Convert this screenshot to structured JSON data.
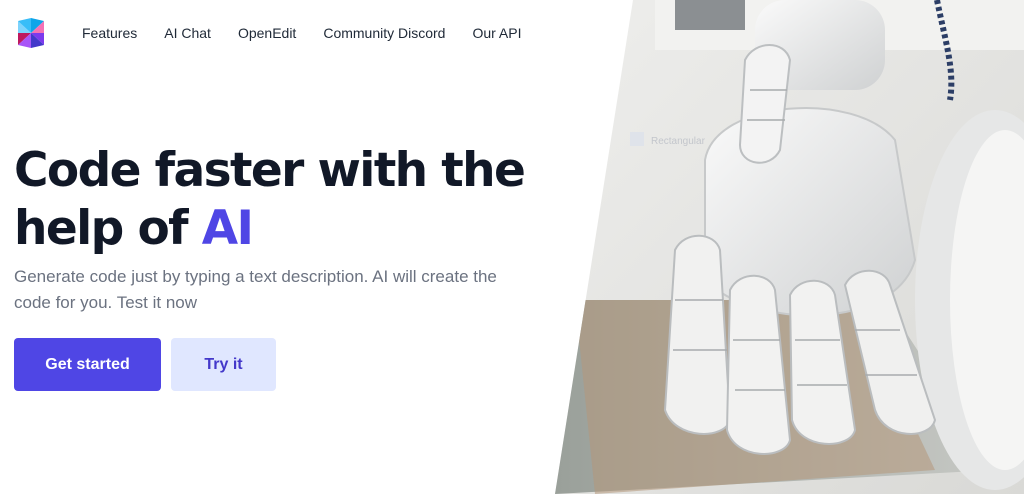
{
  "nav": {
    "logo_icon": "brand-logo-icon",
    "links": [
      {
        "label": "Features"
      },
      {
        "label": "AI Chat"
      },
      {
        "label": "OpenEdit"
      },
      {
        "label": "Community Discord"
      },
      {
        "label": "Our API"
      }
    ]
  },
  "hero": {
    "title_part1": "Code faster with the help of ",
    "title_accent": "AI",
    "subtitle": "Generate code just by typing a text description. AI will create the code for you. Test it now",
    "primary_button": "Get started",
    "secondary_button": "Try it",
    "image_label": "Rectangular",
    "image_icon": "robot-hand-image"
  },
  "colors": {
    "accent": "#4f46e5",
    "secondary_button_bg": "#e0e7ff",
    "heading": "#111827",
    "subtitle": "#6b7280"
  }
}
